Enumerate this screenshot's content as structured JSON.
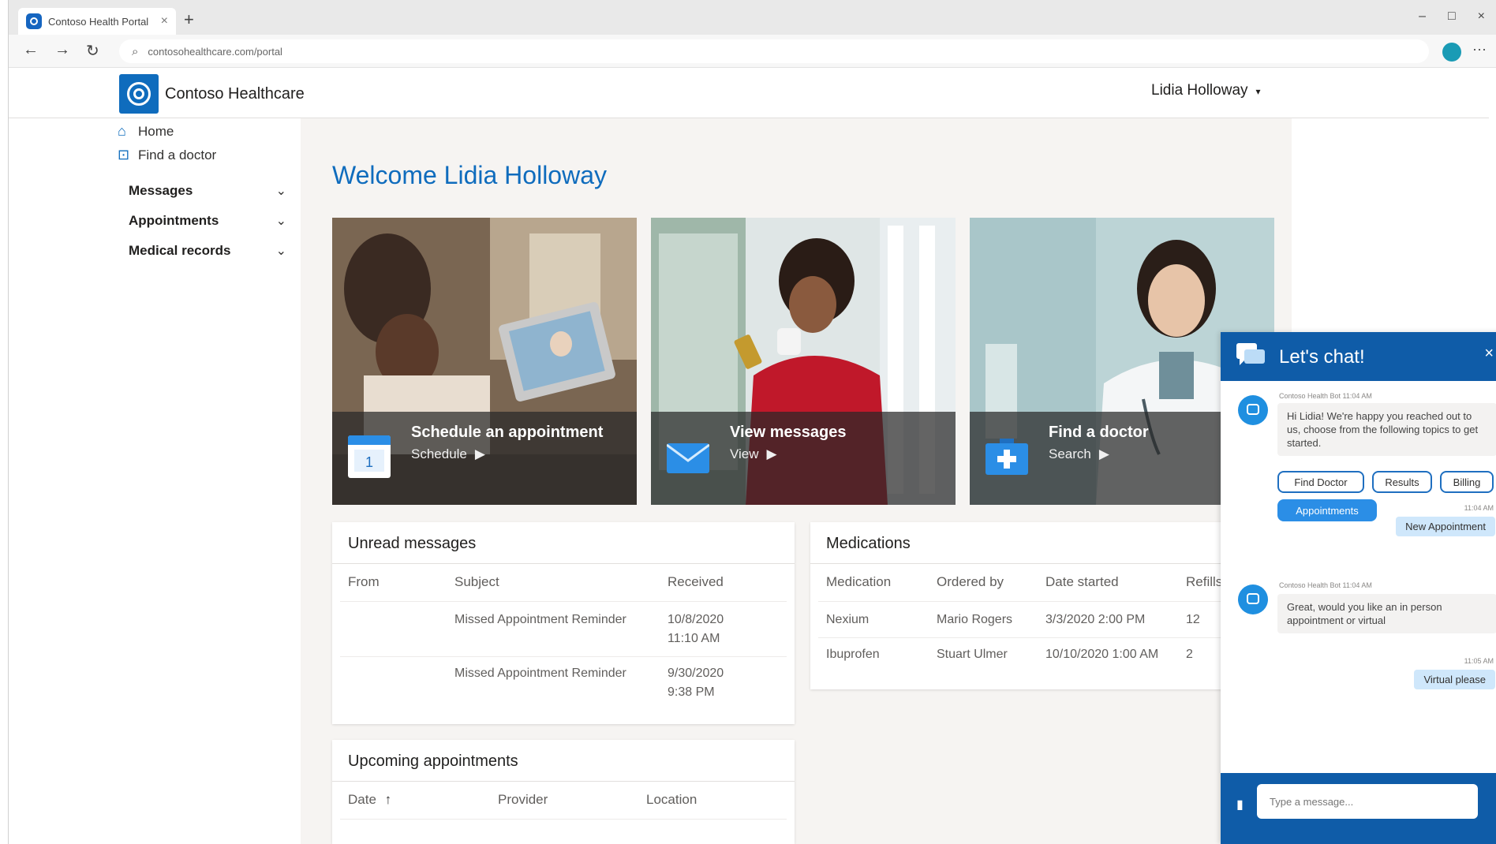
{
  "browser": {
    "tab_title": "Contoso Health Portal",
    "tab_close": "×",
    "new_tab": "+",
    "url": "contosohealthcare.com/portal",
    "window_controls": [
      "–",
      "□",
      "×"
    ],
    "back": "←",
    "forward": "→",
    "refresh": "↻",
    "more": "···"
  },
  "header": {
    "brand": "Contoso Healthcare",
    "user_name": "Lidia Holloway",
    "user_caret": "▾"
  },
  "sidebar": {
    "links": [
      {
        "label": "Home",
        "icon": "home-icon"
      },
      {
        "label": "Find a doctor",
        "icon": "doctor-icon"
      }
    ],
    "groups": [
      {
        "label": "Messages"
      },
      {
        "label": "Appointments"
      },
      {
        "label": "Medical records"
      }
    ],
    "chevron": "⌄"
  },
  "main": {
    "welcome": "Welcome Lidia Holloway",
    "cards": [
      {
        "title": "Schedule an appointment",
        "action": "Schedule"
      },
      {
        "title": "View messages",
        "action": "View"
      },
      {
        "title": "Find a doctor",
        "action": "Search"
      }
    ],
    "unread": {
      "title": "Unread messages",
      "columns": [
        "From",
        "Subject",
        "Received"
      ],
      "rows": [
        {
          "from": "",
          "subject": "Missed Appointment Reminder",
          "received_date": "10/8/2020",
          "received_time": "11:10 AM"
        },
        {
          "from": "",
          "subject": "Missed Appointment Reminder",
          "received_date": "9/30/2020",
          "received_time": "9:38 PM"
        }
      ]
    },
    "medications": {
      "title": "Medications",
      "columns": [
        "Medication",
        "Ordered by",
        "Date started",
        "Refills"
      ],
      "rows": [
        {
          "medication": "Nexium",
          "ordered_by": "Mario Rogers",
          "date_started": "3/3/2020 2:00 PM",
          "refills": "12"
        },
        {
          "medication": "Ibuprofen",
          "ordered_by": "Stuart Ulmer",
          "date_started": "10/10/2020 1:00 AM",
          "refills": "2"
        }
      ]
    },
    "appointments": {
      "title": "Upcoming appointments",
      "columns": [
        "Date",
        "Provider",
        "Location"
      ],
      "sort_arrow": "🠕"
    }
  },
  "chat": {
    "title": "Let's chat!",
    "close": "×",
    "bot_meta_1": "Contoso Health Bot 11:04 AM",
    "bot_msg_1": "Hi Lidia! We're happy you reached out to us, choose from the following topics to get started.",
    "chips": [
      "Find Doctor",
      "Results",
      "Billing",
      "Appointments"
    ],
    "user_time_1": "11:04 AM",
    "user_msg_1": "New Appointment",
    "bot_meta_2": "Contoso Health Bot 11:04 AM",
    "bot_msg_2": "Great, would you like an in person appointment or virtual",
    "user_time_2": "11:05 AM",
    "user_msg_2": "Virtual please",
    "input_placeholder": "Type a message..."
  },
  "colors": {
    "brand_blue": "#0f6cbd",
    "chat_header": "#0f5ca8",
    "page_bg": "#f6f4f2"
  }
}
